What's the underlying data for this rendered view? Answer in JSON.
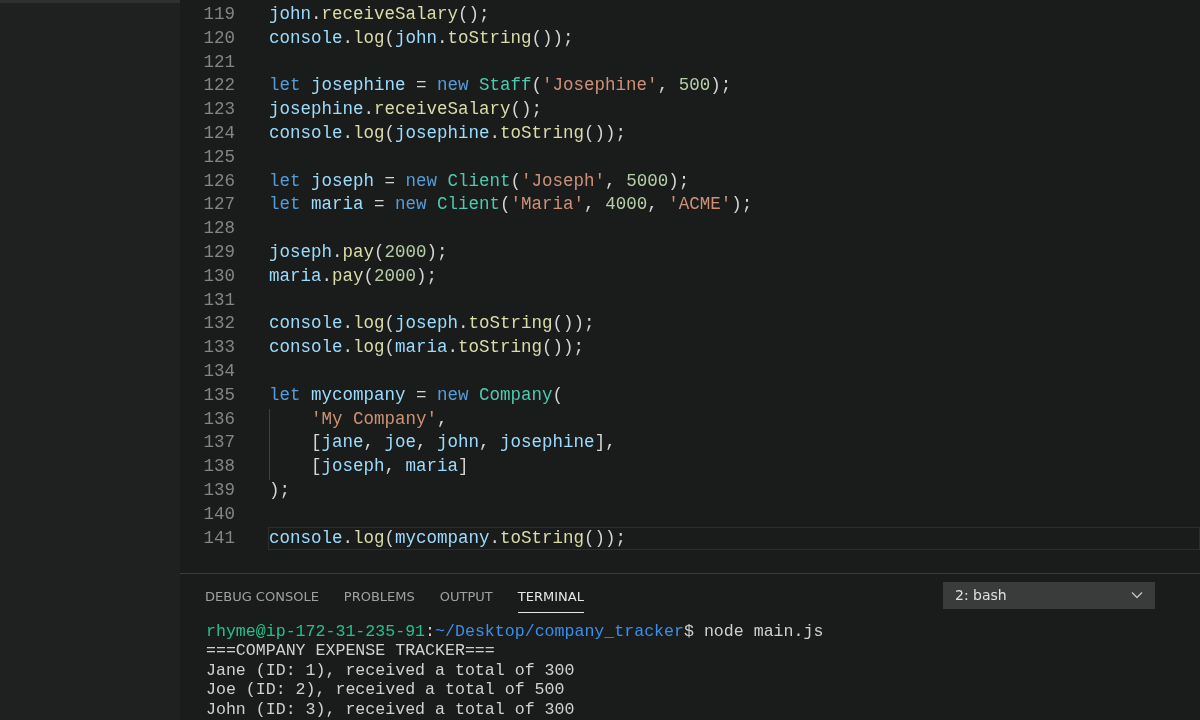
{
  "editor": {
    "lines": [
      {
        "number": "119",
        "current": false,
        "tokens": [
          {
            "kind": "var",
            "text": "john"
          },
          {
            "kind": "punc",
            "text": "."
          },
          {
            "kind": "fn",
            "text": "receiveSalary"
          },
          {
            "kind": "punc",
            "text": "();"
          }
        ]
      },
      {
        "number": "120",
        "current": false,
        "tokens": [
          {
            "kind": "var",
            "text": "console"
          },
          {
            "kind": "punc",
            "text": "."
          },
          {
            "kind": "fn",
            "text": "log"
          },
          {
            "kind": "punc",
            "text": "("
          },
          {
            "kind": "var",
            "text": "john"
          },
          {
            "kind": "punc",
            "text": "."
          },
          {
            "kind": "fn",
            "text": "toString"
          },
          {
            "kind": "punc",
            "text": "());"
          }
        ]
      },
      {
        "number": "121",
        "current": false
      },
      {
        "number": "122",
        "current": false,
        "tokens": [
          {
            "kind": "kw",
            "text": "let "
          },
          {
            "kind": "var",
            "text": "josephine"
          },
          {
            "kind": "punc",
            "text": " = "
          },
          {
            "kind": "kw",
            "text": "new "
          },
          {
            "kind": "cls",
            "text": "Staff"
          },
          {
            "kind": "punc",
            "text": "("
          },
          {
            "kind": "str",
            "text": "'Josephine'"
          },
          {
            "kind": "punc",
            "text": ", "
          },
          {
            "kind": "num",
            "text": "500"
          },
          {
            "kind": "punc",
            "text": ");"
          }
        ]
      },
      {
        "number": "123",
        "current": false,
        "tokens": [
          {
            "kind": "var",
            "text": "josephine"
          },
          {
            "kind": "punc",
            "text": "."
          },
          {
            "kind": "fn",
            "text": "receiveSalary"
          },
          {
            "kind": "punc",
            "text": "();"
          }
        ]
      },
      {
        "number": "124",
        "current": false,
        "tokens": [
          {
            "kind": "var",
            "text": "console"
          },
          {
            "kind": "punc",
            "text": "."
          },
          {
            "kind": "fn",
            "text": "log"
          },
          {
            "kind": "punc",
            "text": "("
          },
          {
            "kind": "var",
            "text": "josephine"
          },
          {
            "kind": "punc",
            "text": "."
          },
          {
            "kind": "fn",
            "text": "toString"
          },
          {
            "kind": "punc",
            "text": "());"
          }
        ]
      },
      {
        "number": "125",
        "current": false
      },
      {
        "number": "126",
        "current": false,
        "tokens": [
          {
            "kind": "kw",
            "text": "let "
          },
          {
            "kind": "var",
            "text": "joseph"
          },
          {
            "kind": "punc",
            "text": " = "
          },
          {
            "kind": "kw",
            "text": "new "
          },
          {
            "kind": "cls",
            "text": "Client"
          },
          {
            "kind": "punc",
            "text": "("
          },
          {
            "kind": "str",
            "text": "'Joseph'"
          },
          {
            "kind": "punc",
            "text": ", "
          },
          {
            "kind": "num",
            "text": "5000"
          },
          {
            "kind": "punc",
            "text": ");"
          }
        ]
      },
      {
        "number": "127",
        "current": false,
        "tokens": [
          {
            "kind": "kw",
            "text": "let "
          },
          {
            "kind": "var",
            "text": "maria"
          },
          {
            "kind": "punc",
            "text": " = "
          },
          {
            "kind": "kw",
            "text": "new "
          },
          {
            "kind": "cls",
            "text": "Client"
          },
          {
            "kind": "punc",
            "text": "("
          },
          {
            "kind": "str",
            "text": "'Maria'"
          },
          {
            "kind": "punc",
            "text": ", "
          },
          {
            "kind": "num",
            "text": "4000"
          },
          {
            "kind": "punc",
            "text": ", "
          },
          {
            "kind": "str",
            "text": "'ACME'"
          },
          {
            "kind": "punc",
            "text": ");"
          }
        ]
      },
      {
        "number": "128",
        "current": false
      },
      {
        "number": "129",
        "current": false,
        "tokens": [
          {
            "kind": "var",
            "text": "joseph"
          },
          {
            "kind": "punc",
            "text": "."
          },
          {
            "kind": "fn",
            "text": "pay"
          },
          {
            "kind": "punc",
            "text": "("
          },
          {
            "kind": "num",
            "text": "2000"
          },
          {
            "kind": "punc",
            "text": ");"
          }
        ]
      },
      {
        "number": "130",
        "current": false,
        "tokens": [
          {
            "kind": "var",
            "text": "maria"
          },
          {
            "kind": "punc",
            "text": "."
          },
          {
            "kind": "fn",
            "text": "pay"
          },
          {
            "kind": "punc",
            "text": "("
          },
          {
            "kind": "num",
            "text": "2000"
          },
          {
            "kind": "punc",
            "text": ");"
          }
        ]
      },
      {
        "number": "131",
        "current": false
      },
      {
        "number": "132",
        "current": false,
        "tokens": [
          {
            "kind": "var",
            "text": "console"
          },
          {
            "kind": "punc",
            "text": "."
          },
          {
            "kind": "fn",
            "text": "log"
          },
          {
            "kind": "punc",
            "text": "("
          },
          {
            "kind": "var",
            "text": "joseph"
          },
          {
            "kind": "punc",
            "text": "."
          },
          {
            "kind": "fn",
            "text": "toString"
          },
          {
            "kind": "punc",
            "text": "());"
          }
        ]
      },
      {
        "number": "133",
        "current": false,
        "tokens": [
          {
            "kind": "var",
            "text": "console"
          },
          {
            "kind": "punc",
            "text": "."
          },
          {
            "kind": "fn",
            "text": "log"
          },
          {
            "kind": "punc",
            "text": "("
          },
          {
            "kind": "var",
            "text": "maria"
          },
          {
            "kind": "punc",
            "text": "."
          },
          {
            "kind": "fn",
            "text": "toString"
          },
          {
            "kind": "punc",
            "text": "());"
          }
        ]
      },
      {
        "number": "134",
        "current": false
      },
      {
        "number": "135",
        "current": false,
        "tokens": [
          {
            "kind": "kw",
            "text": "let "
          },
          {
            "kind": "var",
            "text": "mycompany"
          },
          {
            "kind": "punc",
            "text": " = "
          },
          {
            "kind": "kw",
            "text": "new "
          },
          {
            "kind": "cls",
            "text": "Company"
          },
          {
            "kind": "punc",
            "text": "("
          }
        ]
      },
      {
        "number": "136",
        "current": false,
        "indented": true,
        "tokens": [
          {
            "kind": "str",
            "text": "'My Company'"
          },
          {
            "kind": "punc",
            "text": ","
          }
        ]
      },
      {
        "number": "137",
        "current": false,
        "indented": true,
        "tokens": [
          {
            "kind": "punc",
            "text": "["
          },
          {
            "kind": "var",
            "text": "jane"
          },
          {
            "kind": "punc",
            "text": ", "
          },
          {
            "kind": "var",
            "text": "joe"
          },
          {
            "kind": "punc",
            "text": ", "
          },
          {
            "kind": "var",
            "text": "john"
          },
          {
            "kind": "punc",
            "text": ", "
          },
          {
            "kind": "var",
            "text": "josephine"
          },
          {
            "kind": "punc",
            "text": "],"
          }
        ]
      },
      {
        "number": "138",
        "current": false,
        "indented": true,
        "tokens": [
          {
            "kind": "punc",
            "text": "["
          },
          {
            "kind": "var",
            "text": "joseph"
          },
          {
            "kind": "punc",
            "text": ", "
          },
          {
            "kind": "var",
            "text": "maria"
          },
          {
            "kind": "punc",
            "text": "]"
          }
        ]
      },
      {
        "number": "139",
        "current": false,
        "tokens": [
          {
            "kind": "punc",
            "text": ");"
          }
        ]
      },
      {
        "number": "140",
        "current": false
      },
      {
        "number": "141",
        "current": true,
        "tokens": [
          {
            "kind": "var",
            "text": "console"
          },
          {
            "kind": "punc",
            "text": "."
          },
          {
            "kind": "fn",
            "text": "log"
          },
          {
            "kind": "punc",
            "text": "("
          },
          {
            "kind": "var",
            "text": "mycompany"
          },
          {
            "kind": "punc",
            "text": "."
          },
          {
            "kind": "fn",
            "text": "toString"
          },
          {
            "kind": "punc",
            "text": "());"
          }
        ]
      }
    ]
  },
  "panel": {
    "tabs": [
      {
        "label": "DEBUG CONSOLE",
        "selected": false
      },
      {
        "label": "PROBLEMS",
        "selected": false
      },
      {
        "label": "OUTPUT",
        "selected": false
      },
      {
        "label": "TERMINAL",
        "selected": true
      }
    ],
    "terminal_select": {
      "value": "2: bash"
    },
    "terminal_lines": [
      {
        "segments": [
          {
            "kind": "user",
            "text": "rhyme@ip-172-31-235-91"
          },
          {
            "kind": "plain",
            "text": ":"
          },
          {
            "kind": "path",
            "text": "~/Desktop/company_tracker"
          },
          {
            "kind": "plain",
            "text": "$ node main.js"
          }
        ]
      },
      {
        "segments": [
          {
            "kind": "plain",
            "text": "===COMPANY EXPENSE TRACKER==="
          }
        ]
      },
      {
        "segments": [
          {
            "kind": "plain",
            "text": "Jane (ID: 1), received a total of 300"
          }
        ]
      },
      {
        "segments": [
          {
            "kind": "plain",
            "text": "Joe (ID: 2), received a total of 500"
          }
        ]
      },
      {
        "segments": [
          {
            "kind": "plain",
            "text": "John (ID: 3), received a total of 300"
          }
        ]
      }
    ]
  }
}
